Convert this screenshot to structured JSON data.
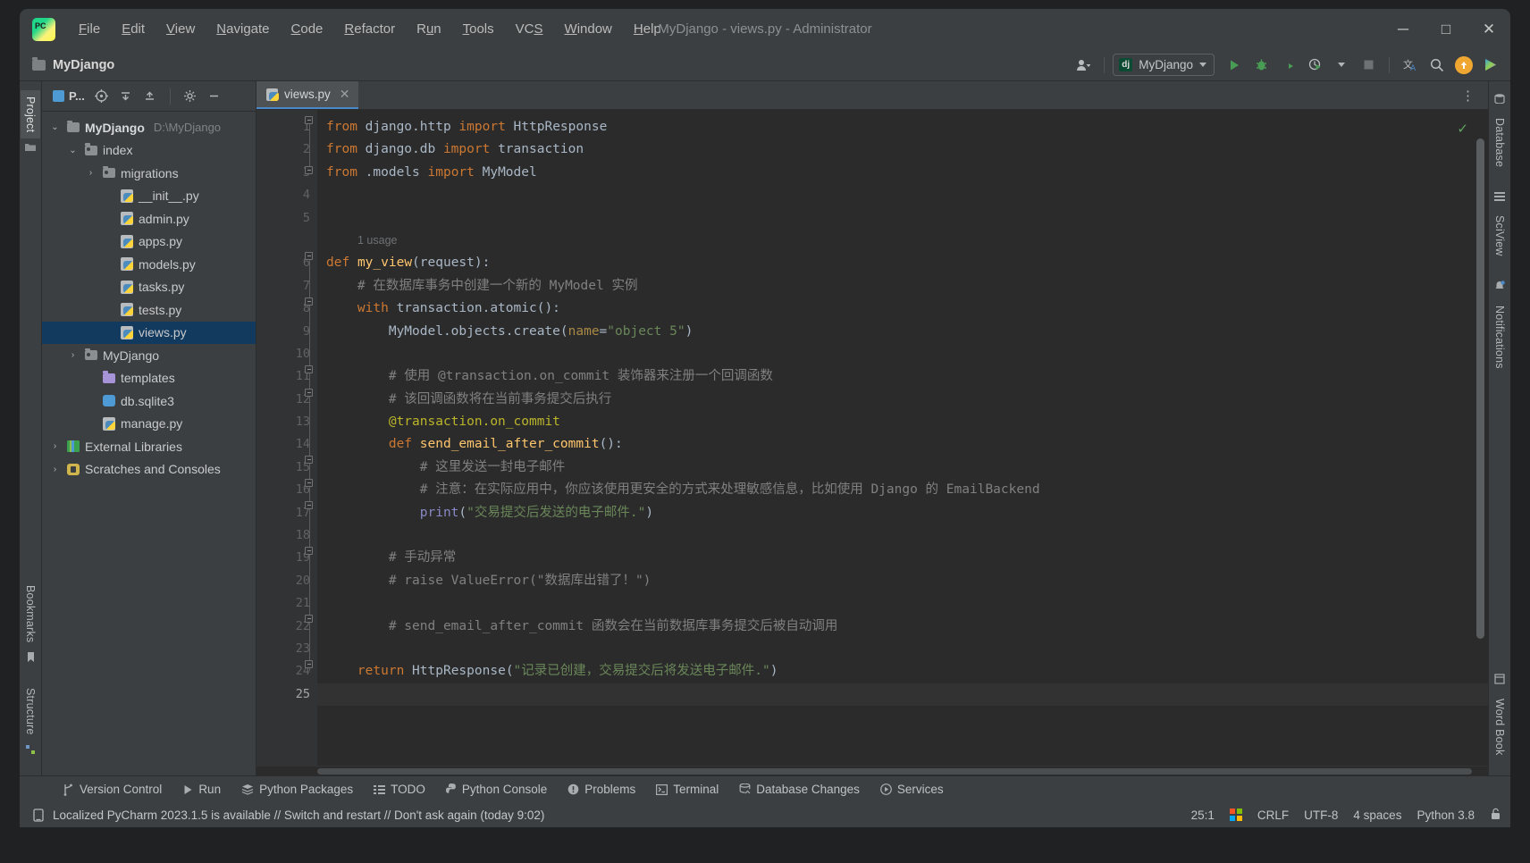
{
  "window": {
    "title": "MyDjango - views.py - Administrator",
    "minimize": "─",
    "maximize": "□",
    "close": "✕"
  },
  "menu": [
    {
      "label": "File",
      "mnemonic": "F"
    },
    {
      "label": "Edit",
      "mnemonic": "E"
    },
    {
      "label": "View",
      "mnemonic": "V"
    },
    {
      "label": "Navigate",
      "mnemonic": "N"
    },
    {
      "label": "Code",
      "mnemonic": "C"
    },
    {
      "label": "Refactor",
      "mnemonic": "R"
    },
    {
      "label": "Run",
      "mnemonic": "R"
    },
    {
      "label": "Tools",
      "mnemonic": "T"
    },
    {
      "label": "VCS",
      "mnemonic": "S"
    },
    {
      "label": "Window",
      "mnemonic": "W"
    },
    {
      "label": "Help",
      "mnemonic": "H"
    }
  ],
  "navbar": {
    "breadcrumb": "MyDjango",
    "run_config": "MyDjango",
    "run_config_icon": "dj",
    "account_icon": "user-icon",
    "run_icon": "run-icon",
    "debug_icon": "debug-icon",
    "coverage_icon": "coverage-icon",
    "profile_icon": "profile-icon",
    "stop_icon": "stop-icon",
    "translate_icon": "translate-icon",
    "search_icon": "search-icon",
    "update_icon": "update-arrow-icon",
    "extra_icon": "plugin-icon"
  },
  "left_strip": {
    "project_tab": "Project",
    "bookmarks_tab": "Bookmarks",
    "structure_tab": "Structure"
  },
  "right_strip": {
    "database_tab": "Database",
    "sciview_tab": "SciView",
    "notifications_tab": "Notifications",
    "wordbook_tab": "Word Book"
  },
  "project_panel": {
    "selector": "P...",
    "header_icons": [
      "locate-icon",
      "collapse-all-icon",
      "expand-all-icon",
      "settings-icon",
      "hide-icon"
    ],
    "tree": [
      {
        "label": "MyDjango",
        "path": "D:\\MyDjango",
        "indent": 0,
        "arrow": "down",
        "icon": "folder-grey",
        "bold": true,
        "selected": false
      },
      {
        "label": "index",
        "path": "",
        "indent": 1,
        "arrow": "down",
        "icon": "folder-module",
        "bold": false,
        "selected": false
      },
      {
        "label": "migrations",
        "path": "",
        "indent": 2,
        "arrow": "right",
        "icon": "folder-module",
        "bold": false,
        "selected": false
      },
      {
        "label": "__init__.py",
        "path": "",
        "indent": 3,
        "arrow": "",
        "icon": "python-file",
        "bold": false,
        "selected": false
      },
      {
        "label": "admin.py",
        "path": "",
        "indent": 3,
        "arrow": "",
        "icon": "python-file",
        "bold": false,
        "selected": false
      },
      {
        "label": "apps.py",
        "path": "",
        "indent": 3,
        "arrow": "",
        "icon": "python-file",
        "bold": false,
        "selected": false
      },
      {
        "label": "models.py",
        "path": "",
        "indent": 3,
        "arrow": "",
        "icon": "python-file",
        "bold": false,
        "selected": false
      },
      {
        "label": "tasks.py",
        "path": "",
        "indent": 3,
        "arrow": "",
        "icon": "python-file",
        "bold": false,
        "selected": false
      },
      {
        "label": "tests.py",
        "path": "",
        "indent": 3,
        "arrow": "",
        "icon": "python-file",
        "bold": false,
        "selected": false
      },
      {
        "label": "views.py",
        "path": "",
        "indent": 3,
        "arrow": "",
        "icon": "python-file",
        "bold": false,
        "selected": true
      },
      {
        "label": "MyDjango",
        "path": "",
        "indent": 1,
        "arrow": "right",
        "icon": "folder-module",
        "bold": false,
        "selected": false
      },
      {
        "label": "templates",
        "path": "",
        "indent": 2,
        "arrow": "",
        "icon": "folder-purple",
        "bold": false,
        "selected": false
      },
      {
        "label": "db.sqlite3",
        "path": "",
        "indent": 2,
        "arrow": "",
        "icon": "database-file",
        "bold": false,
        "selected": false
      },
      {
        "label": "manage.py",
        "path": "",
        "indent": 2,
        "arrow": "",
        "icon": "python-file",
        "bold": false,
        "selected": false
      },
      {
        "label": "External Libraries",
        "path": "",
        "indent": 0,
        "arrow": "right",
        "icon": "library",
        "bold": false,
        "selected": false
      },
      {
        "label": "Scratches and Consoles",
        "path": "",
        "indent": 0,
        "arrow": "right",
        "icon": "scratches",
        "bold": false,
        "selected": false
      }
    ]
  },
  "editor": {
    "tab": {
      "label": "views.py",
      "icon": "python-file",
      "close": "✕"
    },
    "options_icon": "more-options-icon",
    "inspection_status": "✓",
    "usage_hint": "1 usage",
    "lines": [
      {
        "n": 1,
        "html": "<span class='kw'>from</span> django.http <span class='kw'>import</span> HttpResponse"
      },
      {
        "n": 2,
        "html": "<span class='kw'>from</span> django.db <span class='kw'>import</span> transaction"
      },
      {
        "n": 3,
        "html": "<span class='kw'>from</span> .models <span class='kw'>import</span> MyModel"
      },
      {
        "n": 4,
        "html": ""
      },
      {
        "n": 5,
        "html": ""
      },
      {
        "n": 6,
        "html": "<span class='kw'>def</span> <span class='fn'>my_view</span>(request):"
      },
      {
        "n": 7,
        "html": "    <span class='cmt'># 在数据库事务中创建一个新的 MyModel 实例</span>"
      },
      {
        "n": 8,
        "html": "    <span class='kw'>with</span> transaction.atomic():"
      },
      {
        "n": 9,
        "html": "        MyModel.objects.create(<span class='parm'>name</span>=<span class='str'>\"object 5\"</span>)"
      },
      {
        "n": 10,
        "html": ""
      },
      {
        "n": 11,
        "html": "        <span class='cmt'># 使用 @transaction.on_commit 装饰器来注册一个回调函数</span>"
      },
      {
        "n": 12,
        "html": "        <span class='cmt'># 该回调函数将在当前事务提交后执行</span>"
      },
      {
        "n": 13,
        "html": "        <span class='dec'>@transaction.on_commit</span>"
      },
      {
        "n": 14,
        "html": "        <span class='kw'>def</span> <span class='fn'>send_email_after_commit</span>():"
      },
      {
        "n": 15,
        "html": "            <span class='cmt'># 这里发送一封电子邮件</span>"
      },
      {
        "n": 16,
        "html": "            <span class='cmt'># 注意：在实际应用中，你应该使用更安全的方式来处理敏感信息，比如使用 Django 的 EmailBackend</span>"
      },
      {
        "n": 17,
        "html": "            <span class='pyfn'>print</span>(<span class='str'>\"交易提交后发送的电子邮件.\"</span>)"
      },
      {
        "n": 18,
        "html": ""
      },
      {
        "n": 19,
        "html": "        <span class='cmt'># 手动异常</span>"
      },
      {
        "n": 20,
        "html": "        <span class='cmt'># raise ValueError(\"数据库出错了！\")</span>"
      },
      {
        "n": 21,
        "html": ""
      },
      {
        "n": 22,
        "html": "        <span class='cmt'># send_email_after_commit 函数会在当前数据库事务提交后被自动调用</span>"
      },
      {
        "n": 23,
        "html": ""
      },
      {
        "n": 24,
        "html": "    <span class='kw'>return</span> <span class='cls'>HttpResponse</span>(<span class='str'>\"记录已创建，交易提交后将发送电子邮件.\"</span>)"
      },
      {
        "n": 25,
        "html": "",
        "current": true
      }
    ]
  },
  "tool_windows": [
    {
      "label": "Version Control",
      "icon": "branch-icon"
    },
    {
      "label": "Run",
      "icon": "run-icon"
    },
    {
      "label": "Python Packages",
      "icon": "packages-icon"
    },
    {
      "label": "TODO",
      "icon": "todo-icon"
    },
    {
      "label": "Python Console",
      "icon": "python-icon"
    },
    {
      "label": "Problems",
      "icon": "problems-icon"
    },
    {
      "label": "Terminal",
      "icon": "terminal-icon"
    },
    {
      "label": "Database Changes",
      "icon": "db-changes-icon"
    },
    {
      "label": "Services",
      "icon": "services-icon"
    }
  ],
  "statusbar": {
    "message": "Localized PyCharm 2023.1.5 is available // Switch and restart // Don't ask again (today 9:02)",
    "message_icon": "notification-icon",
    "caret": "25:1",
    "os_icon": "windows-icon",
    "line_sep": "CRLF",
    "encoding": "UTF-8",
    "indent": "4 spaces",
    "interpreter": "Python 3.8",
    "lock_icon": "unlocked-icon"
  },
  "colors": {
    "accent": "#4a88c7",
    "selection": "#12395e",
    "editor_bg": "#2b2b2b",
    "panel_bg": "#3c3f41",
    "green": "#499c54",
    "orange": "#f0a732"
  }
}
